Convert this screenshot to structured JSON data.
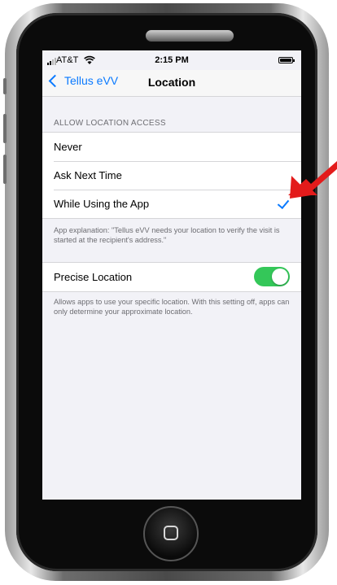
{
  "status_bar": {
    "carrier": "AT&T",
    "time": "2:15 PM"
  },
  "nav": {
    "back_label": "Tellus eVV",
    "title": "Location"
  },
  "location_access": {
    "header": "ALLOW LOCATION ACCESS",
    "options": [
      {
        "label": "Never",
        "selected": false
      },
      {
        "label": "Ask Next Time",
        "selected": false
      },
      {
        "label": "While Using the App",
        "selected": true
      }
    ],
    "footer": "App explanation: \"Tellus eVV needs your location to verify the visit is started at the recipient's address.\""
  },
  "precise_location": {
    "label": "Precise Location",
    "enabled": true,
    "footer": "Allows apps to use your specific location. With this setting off, apps can only determine your approximate location."
  },
  "colors": {
    "accent": "#0a7aff",
    "toggle_on": "#34c759",
    "annotation_arrow": "#e31b1b",
    "background": "#f2f2f7"
  },
  "icons": [
    "signal-bars-icon",
    "wifi-icon",
    "battery-icon",
    "back-chevron-icon",
    "checkmark-icon",
    "red-arrow-annotation-icon",
    "home-button-icon"
  ]
}
